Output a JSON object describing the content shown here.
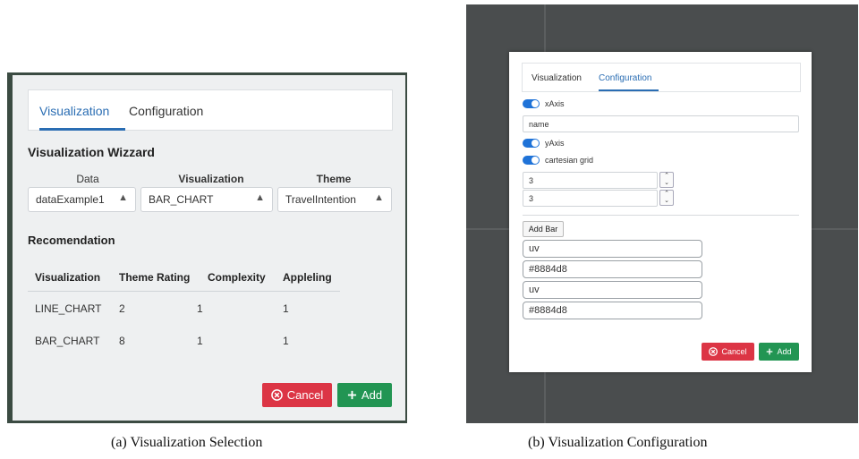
{
  "panel_a": {
    "tabs": [
      "Visualization",
      "Configuration"
    ],
    "active_tab": "Visualization",
    "title": "Visualization Wizzard",
    "column_headers": {
      "data": "Data",
      "visualization": "Visualization",
      "theme": "Theme"
    },
    "selects": {
      "data": "dataExample1",
      "visualization": "BAR_CHART",
      "theme": "TravelIntention"
    },
    "recommendation_title": "Recomendation",
    "table": {
      "headers": [
        "Visualization",
        "Theme Rating",
        "Complexity",
        "Appleling"
      ],
      "rows": [
        [
          "LINE_CHART",
          "2",
          "1",
          "1"
        ],
        [
          "BAR_CHART",
          "8",
          "1",
          "1"
        ]
      ]
    },
    "cancel_label": "Cancel",
    "add_label": "Add",
    "colors": {
      "accent": "#2a6db3",
      "cancel": "#dc3545",
      "add": "#229553"
    }
  },
  "panel_b": {
    "tabs": [
      "Visualization",
      "Configuration"
    ],
    "active_tab": "Configuration",
    "xaxis_label": "xAxis",
    "xaxis_on": true,
    "xaxis_key": "name",
    "yaxis_label": "yAxis",
    "yaxis_on": true,
    "grid_label": "cartesian grid",
    "grid_on": true,
    "spinner_1": "3",
    "spinner_2": "3",
    "add_bar_label": "Add Bar",
    "bars": [
      {
        "key": "uv",
        "color": "#8884d8"
      },
      {
        "key": "uv",
        "color": "#8884d8"
      }
    ],
    "cancel_label": "Cancel",
    "add_label": "Add",
    "colors": {
      "toggle": "#1f73d8",
      "cancel": "#dc3545",
      "add": "#229553"
    }
  },
  "captions": {
    "a": "(a) Visualization Selection",
    "b": "(b) Visualization Configuration"
  }
}
